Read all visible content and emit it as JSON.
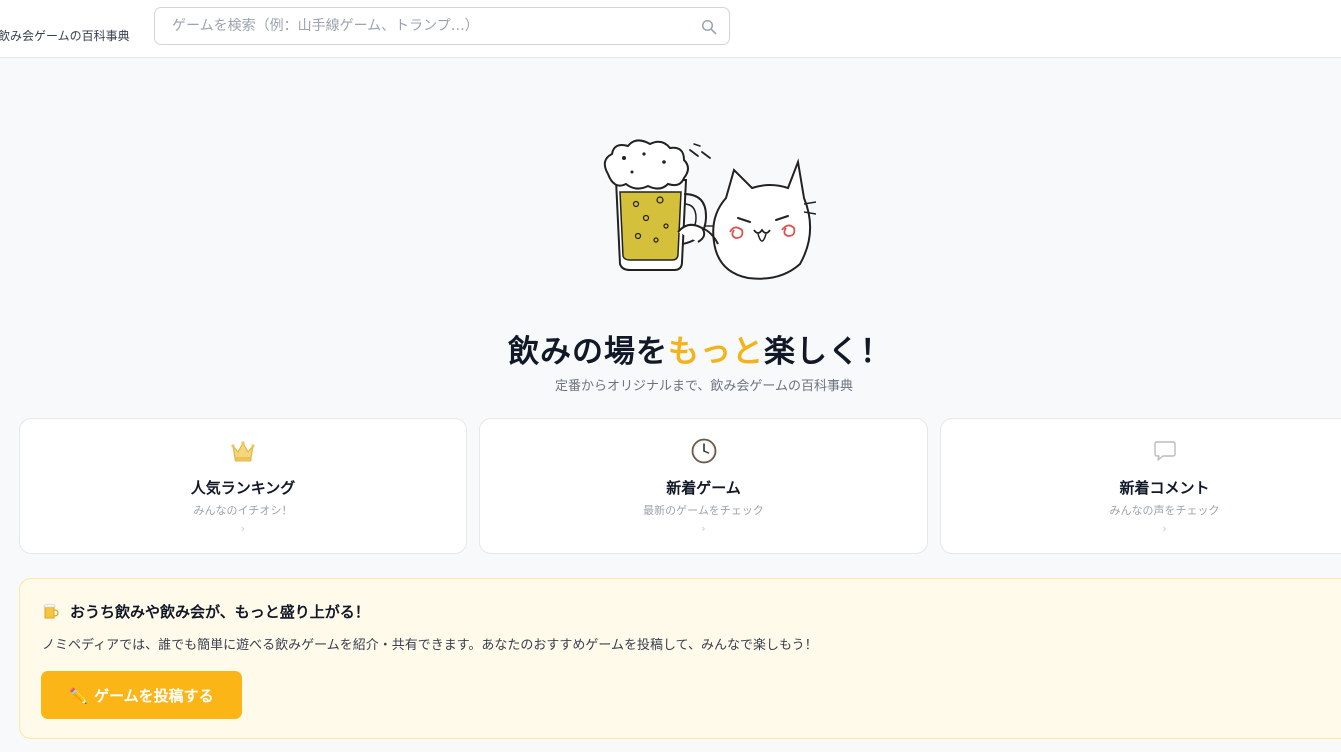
{
  "header": {
    "logo_text": "飲み会ゲームの百科事典",
    "search_placeholder": "ゲームを検索（例：山手線ゲーム、トランプ…）"
  },
  "hero": {
    "title_part1": "飲みの場を",
    "title_accent": "もっと",
    "title_part2": "楽しく！",
    "subtitle": "定番からオリジナルまで、飲み会ゲームの百科事典",
    "accent_color": "#f5b31a"
  },
  "cards": [
    {
      "icon": "crown-icon",
      "title": "人気ランキング",
      "desc": "みんなのイチオシ！",
      "chevron": "›"
    },
    {
      "icon": "clock-icon",
      "title": "新着ゲーム",
      "desc": "最新のゲームをチェック",
      "chevron": "›"
    },
    {
      "icon": "speech-bubble-icon",
      "title": "新着コメント",
      "desc": "みんなの声をチェック",
      "chevron": "›"
    }
  ],
  "promo": {
    "icon": "beer-mug-icon",
    "heading": "おうち飲みや飲み会が、もっと盛り上がる！",
    "text": "ノミペディアでは、誰でも簡単に遊べる飲みゲームを紹介・共有できます。あなたのおすすめゲームを投稿して、みんなで楽しもう！",
    "button_icon": "✏️",
    "button_label": "ゲームを投稿する",
    "button_color": "#fbb517"
  }
}
